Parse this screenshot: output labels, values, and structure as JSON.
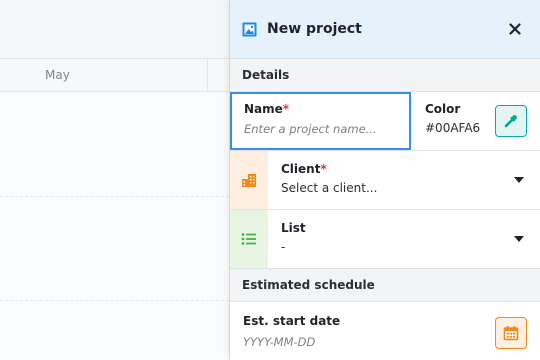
{
  "background": {
    "month_label": "May"
  },
  "panel": {
    "title": "New project",
    "icon": "image-icon",
    "close_icon": "close-icon"
  },
  "details": {
    "section_title": "Details",
    "name": {
      "label": "Name",
      "required_mark": "*",
      "placeholder": "Enter a project name...",
      "value": ""
    },
    "color": {
      "label": "Color",
      "value": "#00AFA6",
      "button_icon": "eyedropper-icon"
    },
    "client": {
      "label": "Client",
      "required_mark": "*",
      "value": "Select a client...",
      "icon": "building-icon",
      "accent": "#f08a1c",
      "accent_bg": "#fdeee0"
    },
    "list": {
      "label": "List",
      "value": "-",
      "icon": "list-icon",
      "accent": "#4caf50",
      "accent_bg": "#e8f5e3"
    }
  },
  "schedule": {
    "section_title": "Estimated schedule",
    "start_date": {
      "label": "Est. start date",
      "placeholder": "YYYY-MM-DD",
      "value": "",
      "button_icon": "calendar-icon"
    }
  }
}
